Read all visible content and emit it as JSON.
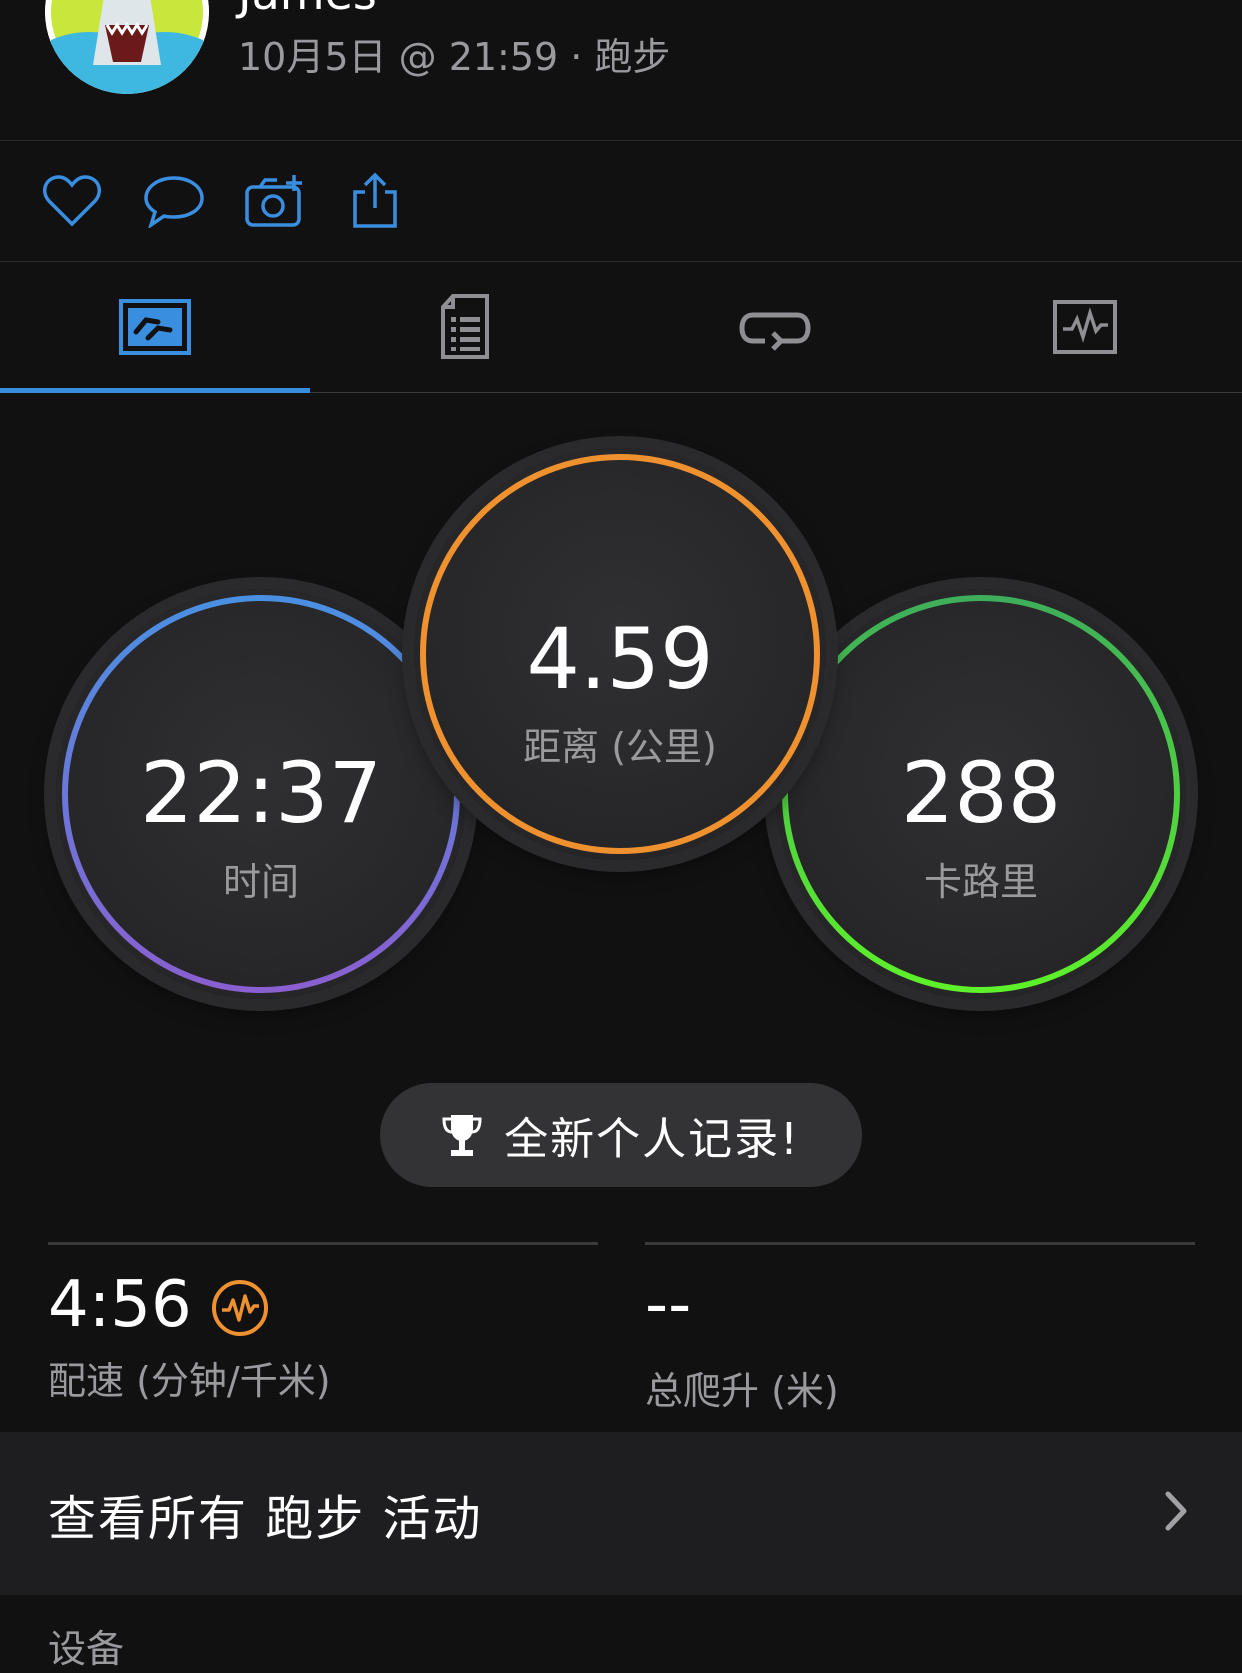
{
  "header": {
    "username": "James",
    "meta": "10月5日 @ 21:59 · 跑步"
  },
  "actions": {
    "icons": [
      "heart-icon",
      "comment-icon",
      "add-photo-icon",
      "share-icon"
    ]
  },
  "tabs": {
    "items": [
      "summary-tab-icon",
      "details-tab-icon",
      "laps-tab-icon",
      "chart-tab-icon"
    ],
    "active_index": 0,
    "accent": "#3a8ee0"
  },
  "metrics": {
    "time": {
      "value": "22:37",
      "label": "时间",
      "ring_colors": [
        "#4a90e2",
        "#8a5fd0"
      ]
    },
    "distance": {
      "value": "4.59",
      "label": "距离 (公里)",
      "ring_color": "#f0912f"
    },
    "calories": {
      "value": "288",
      "label": "卡路里",
      "ring_colors": [
        "#3fae5a",
        "#5ef02a"
      ]
    }
  },
  "record_badge": {
    "text": "全新个人记录!",
    "icon": "trophy-icon"
  },
  "stats": {
    "pace": {
      "value": "4:56",
      "label": "配速 (分钟/千米)",
      "icon": "pace-icon",
      "icon_color": "#f0912f"
    },
    "elevation": {
      "value": "--",
      "label": "总爬升 (米)"
    }
  },
  "link": {
    "text": "查看所有 跑步 活动"
  },
  "section": {
    "title": "设备"
  }
}
